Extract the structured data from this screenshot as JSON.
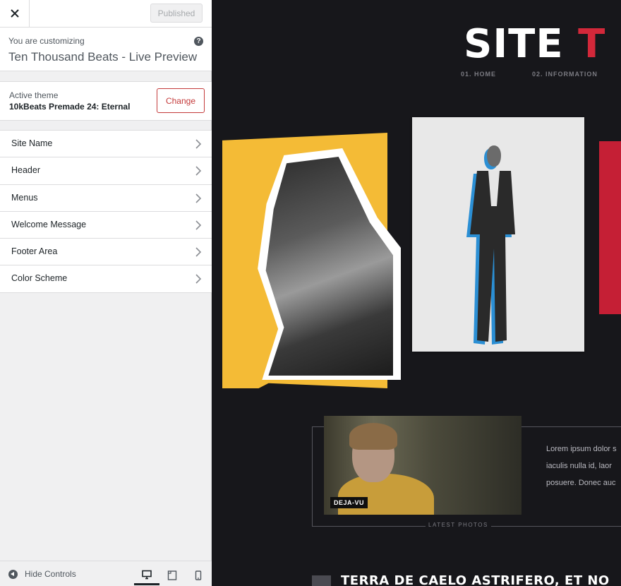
{
  "topbar": {
    "publish_label": "Published"
  },
  "info": {
    "pre": "You are customizing",
    "title": "Ten Thousand Beats - Live Preview",
    "help": "?"
  },
  "theme": {
    "label": "Active theme",
    "name": "10kBeats Premade 24: Eternal",
    "change_label": "Change"
  },
  "sections": [
    {
      "label": "Site Name"
    },
    {
      "label": "Header"
    },
    {
      "label": "Menus"
    },
    {
      "label": "Welcome Message"
    },
    {
      "label": "Footer Area"
    },
    {
      "label": "Color Scheme"
    }
  ],
  "footer": {
    "hide_label": "Hide Controls",
    "active_device": "desktop"
  },
  "preview": {
    "title_white": "SITE ",
    "title_red": "T",
    "nav": [
      "01. HOME",
      "02. INFORMATION"
    ],
    "photo_tag": "DEJA-VU",
    "latest_label": "LATEST PHOTOS",
    "lorem_lines": [
      "Lorem ipsum dolor s",
      "iaculis nulla id, laor",
      "posuere. Donec auc"
    ],
    "heading": "TERRA DE CAELO ASTRIFERO, ET NO"
  },
  "colors": {
    "accent_red": "#c43a3a",
    "site_red": "#d3283a",
    "yellow": "#f4bb36",
    "blue": "#2b8fd4",
    "bg": "#17171b"
  }
}
